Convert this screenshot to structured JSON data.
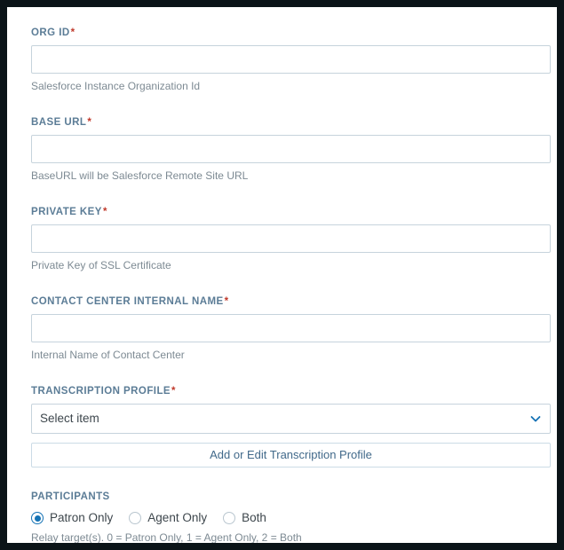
{
  "theme": {
    "frame_color": "#0b1418",
    "card_background": "#ffffff",
    "label_color": "#5b7c96",
    "required_color": "#c0392b",
    "input_border": "#c6d3dc",
    "help_text_color": "#7d8a93",
    "accent_blue": "#1573b5",
    "button_text": "#41698a",
    "button_border": "#cbdbe6"
  },
  "form": {
    "fields": [
      {
        "name": "org-id",
        "label": "ORG ID",
        "required_marker": "*",
        "value": "",
        "placeholder": "",
        "help": "Salesforce Instance Organization Id"
      },
      {
        "name": "base-url",
        "label": "BASE URL",
        "required_marker": "*",
        "value": "",
        "placeholder": "",
        "help": "BaseURL will be Salesforce Remote Site URL"
      },
      {
        "name": "private-key",
        "label": "PRIVATE KEY",
        "required_marker": "*",
        "value": "",
        "placeholder": "",
        "help": "Private Key of SSL Certificate"
      },
      {
        "name": "contact-center-internal-name",
        "label": "CONTACT CENTER INTERNAL NAME",
        "required_marker": "*",
        "value": "",
        "placeholder": "",
        "help": "Internal Name of Contact Center"
      }
    ],
    "transcription_profile": {
      "label": "TRANSCRIPTION PROFILE",
      "required_marker": "*",
      "selected": "Select item",
      "icon": "chevron-down-icon",
      "action_button": "Add or Edit Transcription Profile"
    },
    "participants": {
      "label": "PARTICIPANTS",
      "options": [
        {
          "label": "Patron Only",
          "selected": true
        },
        {
          "label": "Agent Only",
          "selected": false
        },
        {
          "label": "Both",
          "selected": false
        }
      ],
      "help": "Relay target(s). 0 = Patron Only, 1 = Agent Only, 2 = Both"
    }
  }
}
